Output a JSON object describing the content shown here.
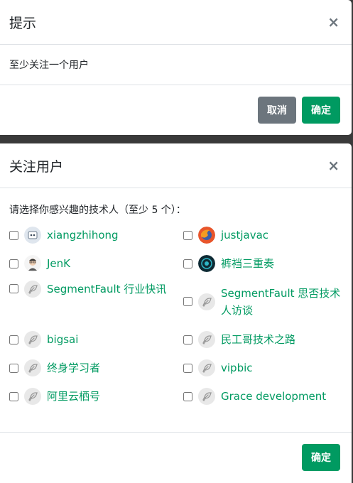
{
  "alert": {
    "title": "提示",
    "close": "×",
    "message": "至少关注一个用户",
    "cancel_label": "取消",
    "confirm_label": "确定"
  },
  "follow": {
    "title": "关注用户",
    "close": "×",
    "prompt": "请选择你感兴趣的技术人（至少 5 个）：",
    "users": [
      {
        "name": "xiangzhihong",
        "avatar": "robot-avatar"
      },
      {
        "name": "justjavac",
        "avatar": "firefox-avatar"
      },
      {
        "name": "JenK",
        "avatar": "person-avatar"
      },
      {
        "name": "裤裆三重奏",
        "avatar": "dark-avatar"
      },
      {
        "name": "SegmentFault 行业快讯",
        "avatar": "default-avatar"
      },
      {
        "name": "SegmentFault 思否技术人访谈",
        "avatar": "default-avatar"
      },
      {
        "name": "bigsai",
        "avatar": "default-avatar"
      },
      {
        "name": "民工哥技术之路",
        "avatar": "default-avatar"
      },
      {
        "name": "终身学习者",
        "avatar": "default-avatar"
      },
      {
        "name": "vipbic",
        "avatar": "default-avatar"
      },
      {
        "name": "阿里云栖号",
        "avatar": "default-avatar"
      },
      {
        "name": "Grace development",
        "avatar": "default-avatar"
      }
    ],
    "confirm_label": "确定"
  },
  "colors": {
    "accent": "#009a61",
    "secondary": "#6c757d"
  }
}
